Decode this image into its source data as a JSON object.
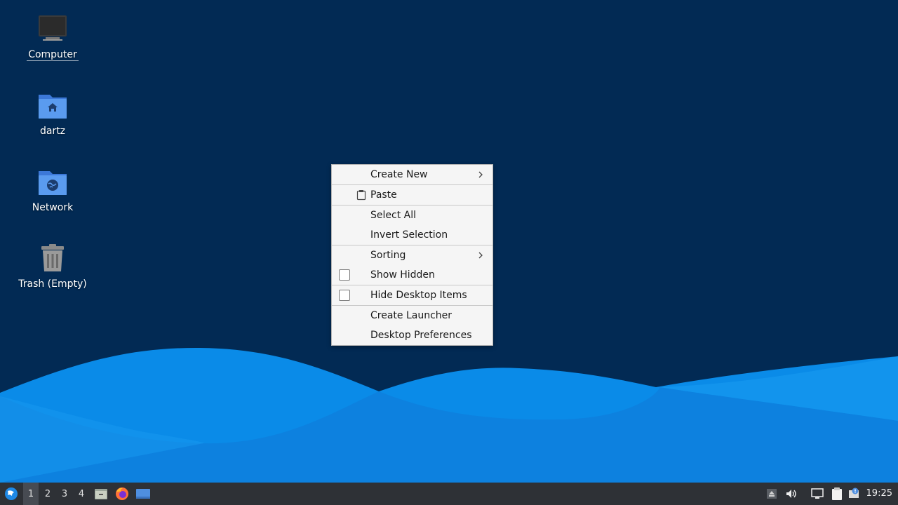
{
  "desktop": {
    "icons": [
      {
        "label": "Computer",
        "icon": "computer-icon"
      },
      {
        "label": "dartz",
        "icon": "home-folder-icon"
      },
      {
        "label": "Network",
        "icon": "network-folder-icon"
      },
      {
        "label": "Trash (Empty)",
        "icon": "trash-icon"
      }
    ]
  },
  "context_menu": {
    "items": [
      {
        "label": "Create New",
        "submenu": true
      },
      {
        "label": "Paste",
        "icon": "clipboard-icon"
      },
      {
        "label": "Select All"
      },
      {
        "label": "Invert Selection"
      },
      {
        "label": "Sorting",
        "submenu": true
      },
      {
        "label": "Show Hidden",
        "checkbox": false
      },
      {
        "label": "Hide Desktop Items",
        "checkbox": false
      },
      {
        "label": "Create Launcher"
      },
      {
        "label": "Desktop Preferences"
      }
    ]
  },
  "taskbar": {
    "workspaces": [
      "1",
      "2",
      "3",
      "4"
    ],
    "active_workspace": "1",
    "launchers": [
      "file-manager-icon",
      "firefox-icon",
      "show-desktop-icon"
    ],
    "tray": [
      "eject-icon",
      "volume-icon",
      "network-status-icon",
      "clipboard-tray-icon",
      "notification-icon"
    ],
    "clock": "19:25"
  },
  "colors": {
    "background": "#022a54",
    "wave_light": "#1a9cf0",
    "wave_mid": "#0b84e6",
    "taskbar": "#2e3136",
    "menu_bg": "#f5f5f5"
  }
}
